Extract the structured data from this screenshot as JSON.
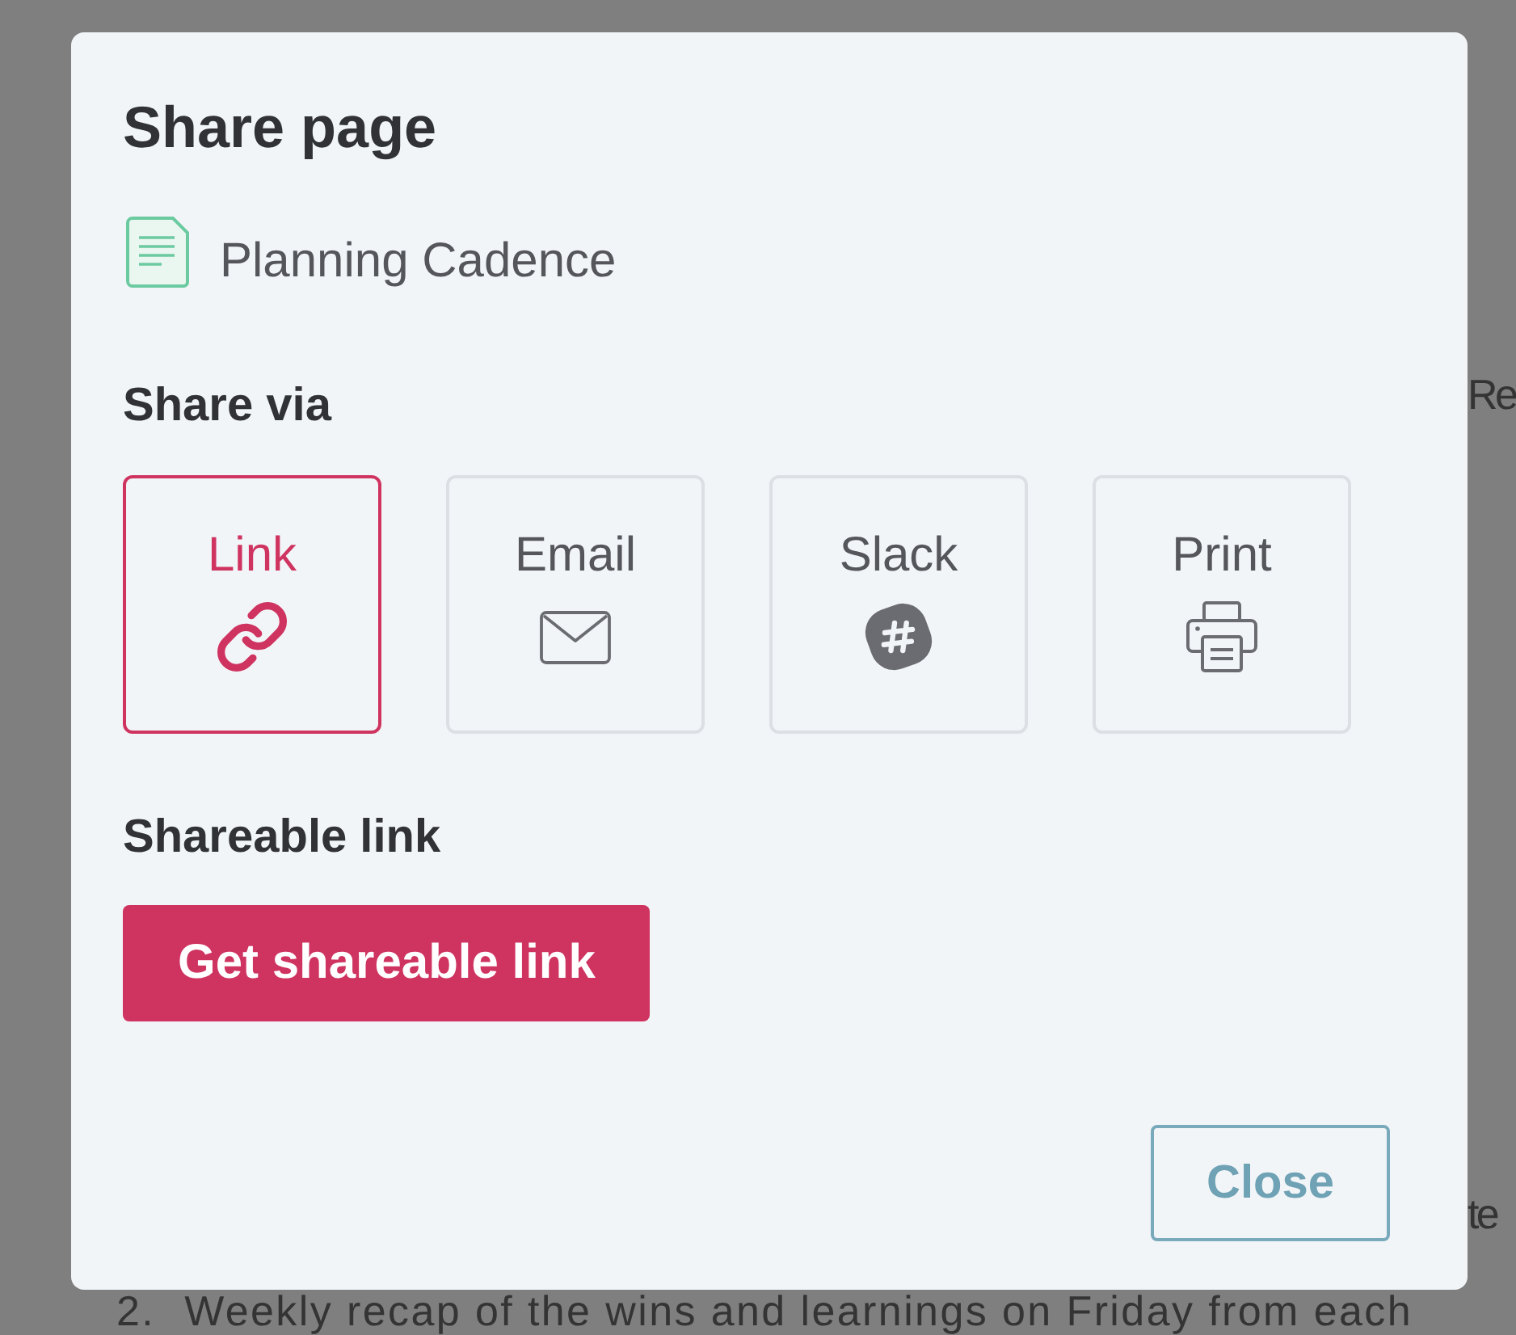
{
  "background_page": {
    "text_fragments": [
      "Re",
      "te"
    ],
    "list_item": {
      "number": "2.",
      "text": "Weekly recap of the wins and learnings on Friday from each"
    }
  },
  "dialog": {
    "title": "Share page",
    "page_name": "Planning Cadence",
    "share_via": {
      "heading": "Share via",
      "options": [
        {
          "kind": "link",
          "label": "Link",
          "selected": true
        },
        {
          "kind": "email",
          "label": "Email",
          "selected": false
        },
        {
          "kind": "slack",
          "label": "Slack",
          "selected": false
        },
        {
          "kind": "print",
          "label": "Print",
          "selected": false
        }
      ]
    },
    "shareable_link": {
      "heading": "Shareable link",
      "button": "Get shareable link"
    },
    "close_button": "Close"
  }
}
